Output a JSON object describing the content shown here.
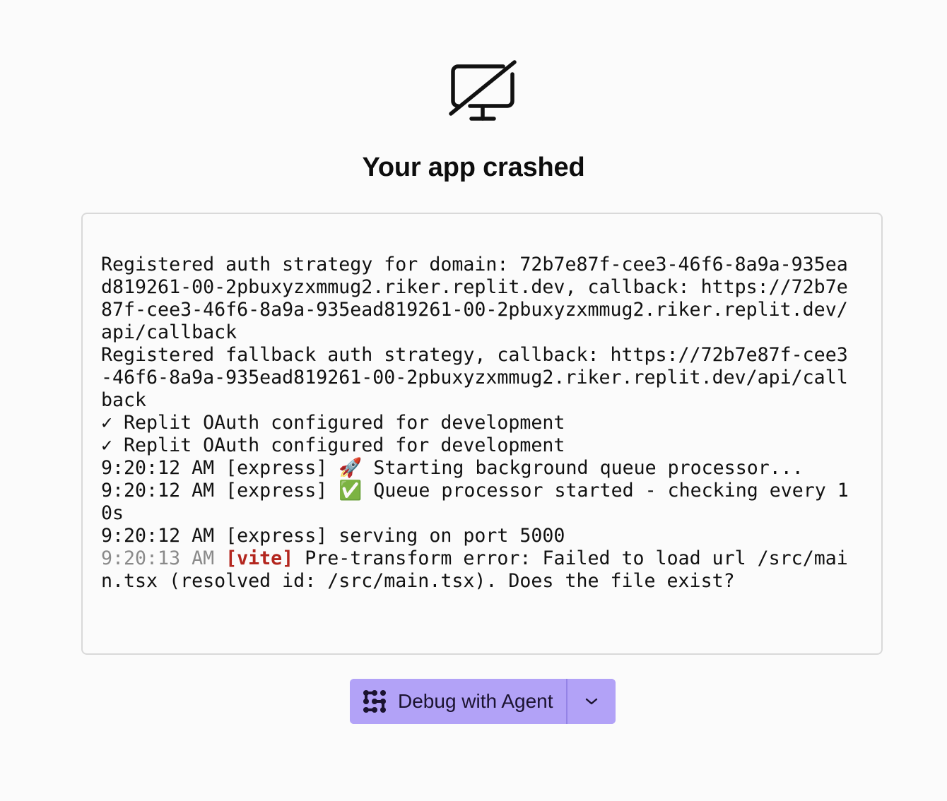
{
  "title": "Your app crashed",
  "icons": {
    "crash": "monitor-off-icon",
    "agent": "agent-icon",
    "dropdown": "chevron-down-icon"
  },
  "log": {
    "lines": [
      "Registered auth strategy for domain: 72b7e87f-cee3-46f6-8a9a-935ea",
      "d819261-00-2pbuxyzxmmug2.riker.replit.dev, callback: https://72b7e",
      "87f-cee3-46f6-8a9a-935ead819261-00-2pbuxyzxmmug2.riker.replit.dev/",
      "api/callback",
      "Registered fallback auth strategy, callback: https://72b7e87f-cee3",
      "-46f6-8a9a-935ead819261-00-2pbuxyzxmmug2.riker.replit.dev/api/call",
      "back",
      "✓ Replit OAuth configured for development",
      "✓ Replit OAuth configured for development",
      "9:20:12 AM [express] 🚀 Starting background queue processor...",
      "9:20:12 AM [express] ✅ Queue processor started - checking every 1",
      "0s",
      "9:20:12 AM [express] serving on port 5000"
    ],
    "vite_error": {
      "timestamp": "9:20:13 AM",
      "tag": "[vite]",
      "line1": "Pre-transform error: Failed to load url /src/mai",
      "line2": "n.tsx (resolved id: /src/main.tsx). Does the file exist?"
    }
  },
  "actions": {
    "debug_label": "Debug with Agent"
  },
  "colors": {
    "button_bg": "#b2a2f7",
    "error_tag": "#b3261e",
    "timestamp_dim": "#8a8a8a"
  }
}
